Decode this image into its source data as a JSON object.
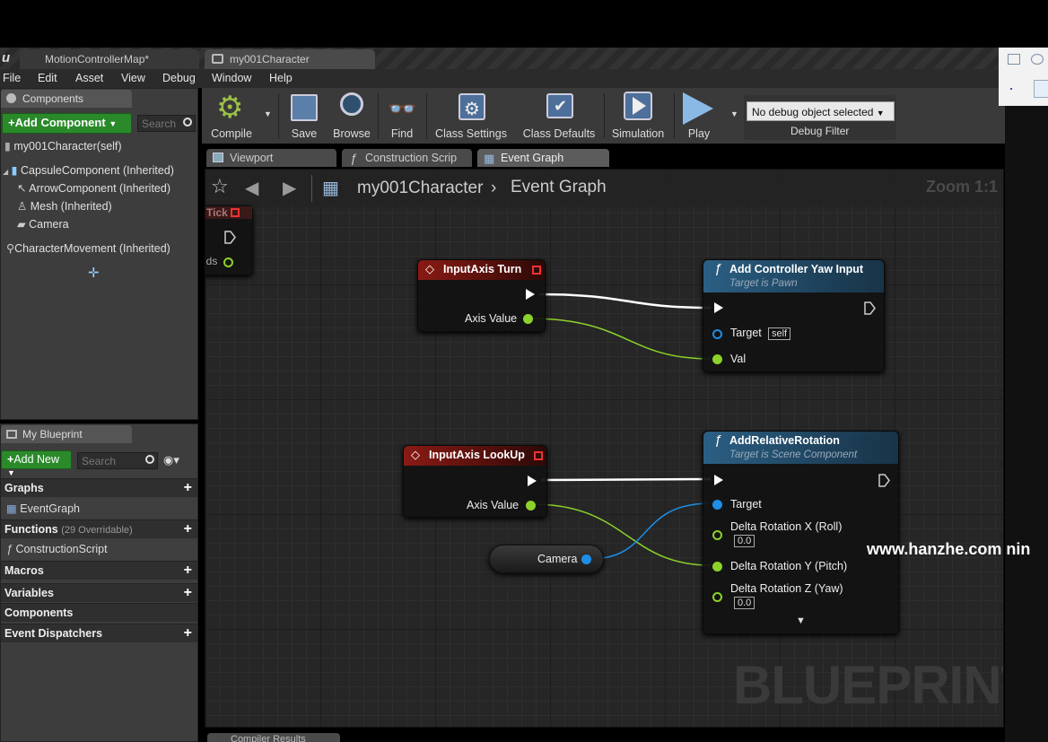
{
  "tabs": [
    {
      "label": "MotionControllerMap*"
    },
    {
      "label": "my001Character"
    }
  ],
  "menu": [
    "File",
    "Edit",
    "Asset",
    "View",
    "Debug",
    "Window",
    "Help"
  ],
  "components_panel": {
    "title": "Components",
    "add_button": "Add Component",
    "search_placeholder": "Search",
    "items": [
      "my001Character(self)",
      "CapsuleComponent (Inherited)",
      "ArrowComponent (Inherited)",
      "Mesh (Inherited)",
      "Camera",
      "CharacterMovement (Inherited)"
    ]
  },
  "my_blueprint": {
    "title": "My Blueprint",
    "add_button": "Add New",
    "search_placeholder": "Search",
    "graphs": "Graphs",
    "event_graph": "EventGraph",
    "functions": "Functions",
    "functions_note": "(29 Overridable)",
    "construction_script": "ConstructionScript",
    "macros": "Macros",
    "variables": "Variables",
    "components": "Components",
    "event_dispatchers": "Event Dispatchers"
  },
  "toolbar": {
    "compile": "Compile",
    "save": "Save",
    "browse": "Browse",
    "find": "Find",
    "class_settings": "Class Settings",
    "class_defaults": "Class Defaults",
    "simulation": "Simulation",
    "play": "Play",
    "debug_select": "No debug object selected",
    "debug_filter": "Debug Filter"
  },
  "editor_tabs": [
    "Viewport",
    "Construction Scrip",
    "Event Graph"
  ],
  "graph": {
    "breadcrumb_root": "my001Character",
    "breadcrumb_leaf": "Event Graph",
    "zoom": "Zoom 1:1",
    "watermark": "BLUEPRINT",
    "partial_tick": "Tick",
    "partial_ends": "nds",
    "nodes": {
      "turn": {
        "title": "InputAxis Turn",
        "pin": "Axis Value"
      },
      "lookup": {
        "title": "InputAxis LookUp",
        "pin": "Axis Value"
      },
      "yaw": {
        "title": "Add Controller Yaw Input",
        "subtitle": "Target is Pawn",
        "target": "Target",
        "target_value": "self",
        "val": "Val"
      },
      "rot": {
        "title": "AddRelativeRotation",
        "subtitle": "Target is Scene Component",
        "target": "Target",
        "x_label": "Delta Rotation X (Roll)",
        "x_value": "0.0",
        "y_label": "Delta Rotation Y (Pitch)",
        "z_label": "Delta Rotation Z (Yaw)",
        "z_value": "0.0"
      },
      "camera": {
        "label": "Camera"
      }
    }
  },
  "bottom_tab": "Compiler Results",
  "overlay_text": "www.hanzhe.com nin",
  "colors": {
    "exec": "#ffffff",
    "float": "#8bd22a",
    "object": "#1e8ee6",
    "event_header": "#8a1a14",
    "function_header": "#2b5f84"
  }
}
